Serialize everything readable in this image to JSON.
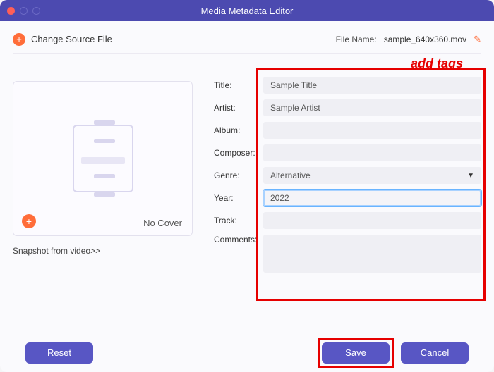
{
  "window": {
    "title": "Media Metadata Editor"
  },
  "top": {
    "change_source": "Change Source File",
    "file_name_label": "File Name:",
    "file_name_value": "sample_640x360.mov"
  },
  "annotation": {
    "add_tags": "add tags"
  },
  "cover": {
    "no_cover": "No Cover",
    "snapshot_link": "Snapshot from video>>"
  },
  "form": {
    "title": {
      "label": "Title:",
      "value": "Sample Title"
    },
    "artist": {
      "label": "Artist:",
      "value": "Sample Artist"
    },
    "album": {
      "label": "Album:",
      "value": ""
    },
    "composer": {
      "label": "Composer:",
      "value": ""
    },
    "genre": {
      "label": "Genre:",
      "value": "Alternative"
    },
    "year": {
      "label": "Year:",
      "value": "2022"
    },
    "track": {
      "label": "Track:",
      "value": ""
    },
    "comments": {
      "label": "Comments:",
      "value": ""
    }
  },
  "buttons": {
    "reset": "Reset",
    "save": "Save",
    "cancel": "Cancel"
  }
}
